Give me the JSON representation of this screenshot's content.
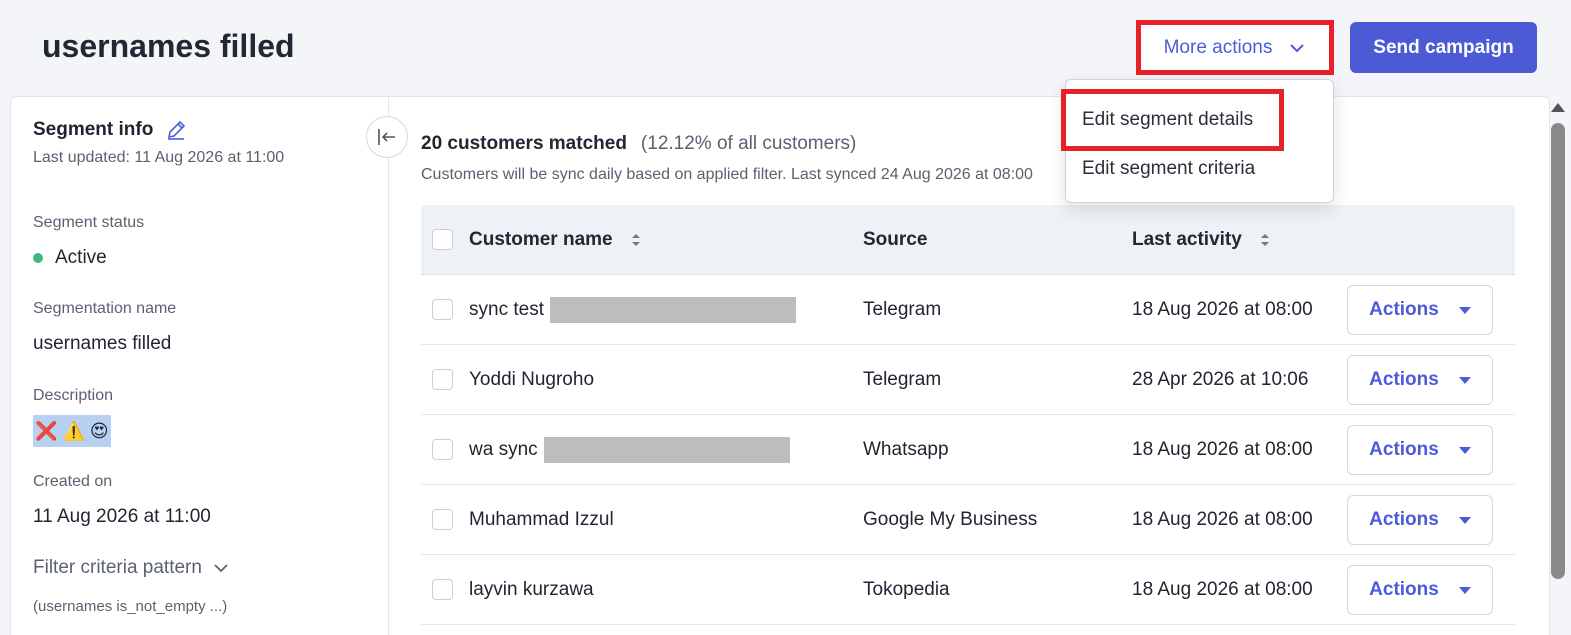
{
  "page": {
    "title": "usernames filled"
  },
  "header": {
    "more_actions_label": "More actions",
    "send_campaign_label": "Send campaign"
  },
  "dropdown": {
    "items": [
      "Edit segment details",
      "Edit segment criteria"
    ]
  },
  "segment_info": {
    "title": "Segment info",
    "last_updated": "Last updated: 11 Aug 2026 at 11:00",
    "status_label": "Segment status",
    "status_value": "Active",
    "name_label": "Segmentation name",
    "name_value": "usernames filled",
    "description_label": "Description",
    "description_emojis": [
      "❌",
      "⚠️",
      "😍"
    ],
    "created_label": "Created on",
    "created_value": "11 Aug 2026 at 11:00",
    "filter_label": "Filter criteria pattern",
    "filter_value": "(usernames is_not_empty ...)"
  },
  "results": {
    "matched_count": "20 customers matched",
    "matched_pct": "(12.12% of all customers)",
    "sync_note": "Customers will be sync daily based on applied filter. Last synced 24 Aug 2026 at 08:00"
  },
  "table": {
    "headers": {
      "name": "Customer name",
      "source": "Source",
      "activity": "Last activity"
    },
    "rows": [
      {
        "name": "sync test",
        "source": "Telegram",
        "activity": "18 Aug 2026 at 08:00",
        "action": "Actions"
      },
      {
        "name": "Yoddi Nugroho",
        "source": "Telegram",
        "activity": "28 Apr 2026 at 10:06",
        "action": "Actions"
      },
      {
        "name": "wa sync",
        "source": "Whatsapp",
        "activity": "18 Aug 2026 at 08:00",
        "action": "Actions"
      },
      {
        "name": "Muhammad Izzul",
        "source": "Google My Business",
        "activity": "18 Aug 2026 at 08:00",
        "action": "Actions"
      },
      {
        "name": "layvin kurzawa",
        "source": "Tokopedia",
        "activity": "18 Aug 2026 at 08:00",
        "action": "Actions"
      }
    ]
  },
  "colors": {
    "accent": "#4c5ad6",
    "highlight": "#e8202a",
    "active": "#3fb87f"
  }
}
